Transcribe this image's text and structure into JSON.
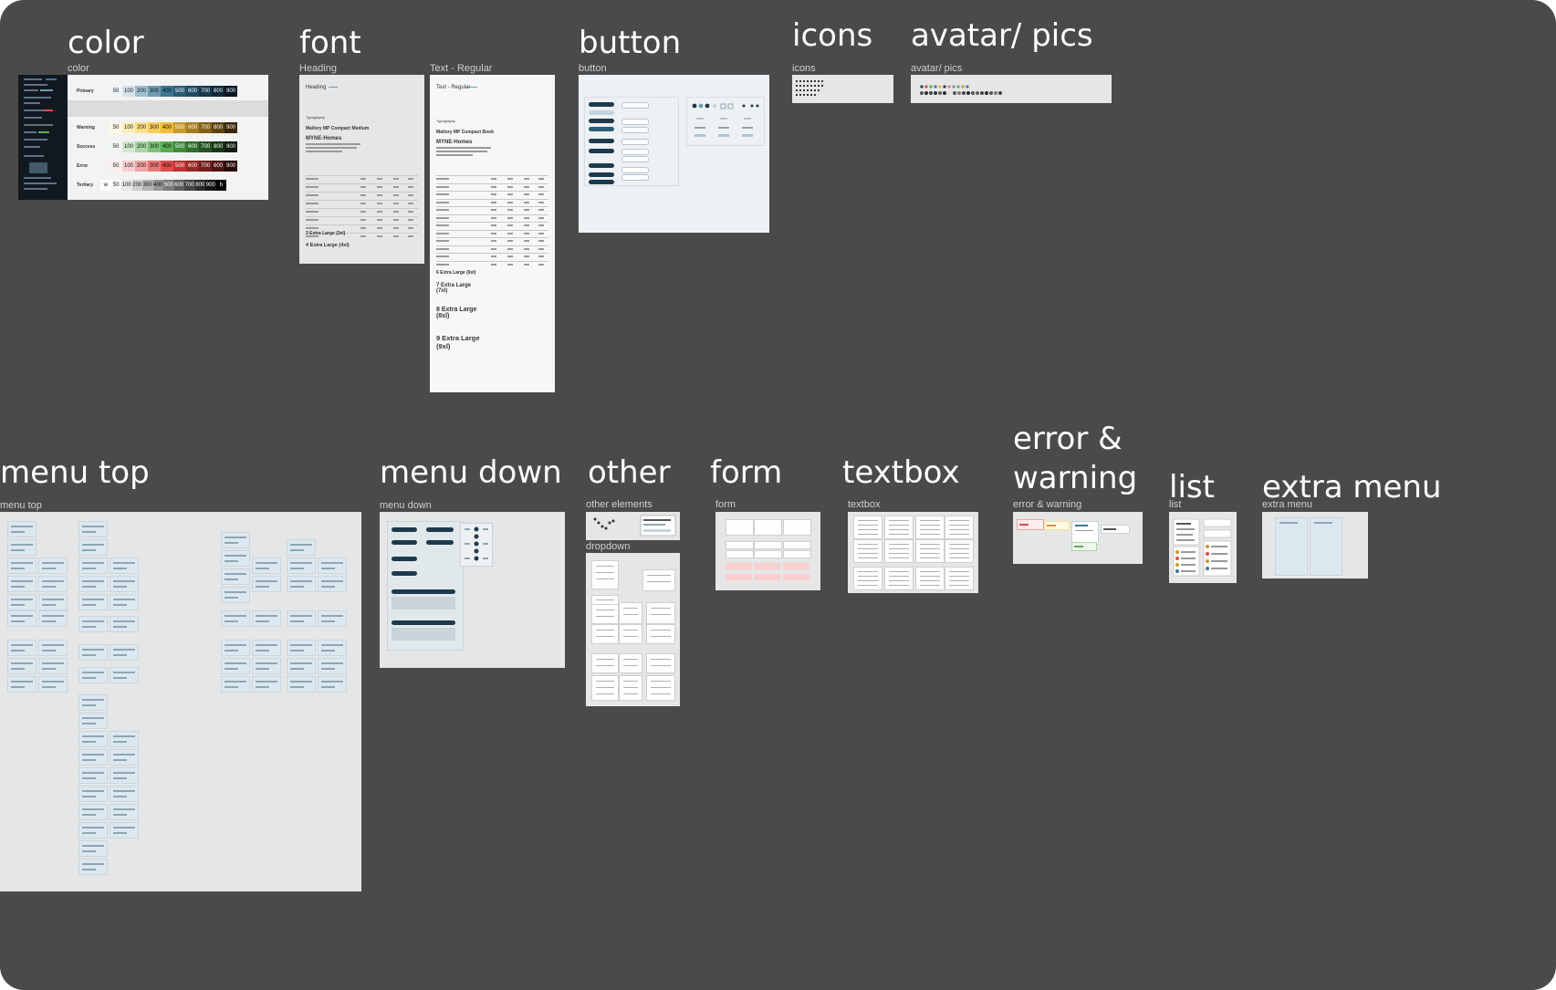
{
  "sections": {
    "color": "color",
    "font": "font",
    "button": "button",
    "icons": "icons",
    "avatar": "avatar/ pics",
    "menu_top": "menu top",
    "menu_down": "menu down",
    "other": "other",
    "form": "form",
    "textbox": "textbox",
    "error_warning": "error & warning",
    "list": "list",
    "extra_menu": "extra menu"
  },
  "frame_labels": {
    "color": "color",
    "heading": "Heading",
    "text_regular": "Text - Regular",
    "button": "button",
    "icons": "icons",
    "avatar": "avatar/ pics",
    "menu_top": "menu top",
    "menu_down": "menu down",
    "other_elements": "other elements",
    "dropdown": "dropdown",
    "form": "form",
    "textbox": "textbox",
    "error_warning": "error & warning",
    "list": "list",
    "extra_menu": "extra menu"
  },
  "color_frame": {
    "palettes": [
      {
        "name": "Primary",
        "shades": [
          "50",
          "100",
          "200",
          "300",
          "400",
          "500",
          "600",
          "700",
          "800",
          "900"
        ],
        "colors": [
          "#eef4f8",
          "#d3e2ec",
          "#9fbfd0",
          "#6f9cb3",
          "#3f7693",
          "#2a5d78",
          "#1f4a61",
          "#17394b",
          "#0f2836",
          "#081822"
        ]
      },
      {
        "name": "Warning",
        "shades": [
          "50",
          "100",
          "200",
          "300",
          "400",
          "500",
          "600",
          "700",
          "800",
          "900"
        ],
        "colors": [
          "#fff8e6",
          "#ffeeb8",
          "#ffe08a",
          "#f7cf5c",
          "#f0bd38",
          "#c99a2a",
          "#a57d20",
          "#806017",
          "#5b430f",
          "#382807"
        ]
      },
      {
        "name": "Success",
        "shades": [
          "50",
          "100",
          "200",
          "300",
          "400",
          "500",
          "600",
          "700",
          "800",
          "900"
        ],
        "colors": [
          "#eef7ee",
          "#d1ebcf",
          "#a7d6a3",
          "#7cc277",
          "#58ad52",
          "#3e8b3a",
          "#306e2d",
          "#245222",
          "#183717",
          "#0c1c0b"
        ]
      },
      {
        "name": "Error",
        "shades": [
          "50",
          "100",
          "200",
          "300",
          "400",
          "500",
          "600",
          "700",
          "800",
          "900"
        ],
        "colors": [
          "#fdeeee",
          "#f9cfcf",
          "#f2a3a3",
          "#ea7575",
          "#e04b4b",
          "#c23232",
          "#9a2727",
          "#731d1d",
          "#4c1313",
          "#260909"
        ]
      },
      {
        "name": "Tertiary",
        "shades": [
          "w",
          "50",
          "100",
          "200",
          "300",
          "400",
          "500",
          "600",
          "700",
          "800",
          "900",
          "b"
        ],
        "colors": [
          "#ffffff",
          "#f7f7f7",
          "#e6e6e6",
          "#cfcfcf",
          "#b3b3b3",
          "#969696",
          "#7a7a7a",
          "#5e5e5e",
          "#434343",
          "#2b2b2b",
          "#161616",
          "#000000"
        ]
      }
    ]
  },
  "font_frame": {
    "heading_title": "Heading",
    "heading_typography": "Typography",
    "heading_font_name": "Mallory MP Compact Medium",
    "heading_sample": "MYNE-Homes",
    "heading_rows": [
      "3 Extra Large (3xl)",
      "4 Extra Large (4xl)"
    ],
    "text_title": "Text - Regular",
    "text_typography": "Typography",
    "text_font_name": "Mallory MP Compact Book",
    "text_sample": "MYNE-Homes",
    "text_rows": [
      "6 Extra Large (6xl)",
      "7 Extra Large (7xl)",
      "8 Extra Large (8xl)",
      "9 Extra Large (9xl)"
    ]
  },
  "colors": {
    "canvas": "#4a4a4a",
    "frame": "#e6e6e6",
    "primary_dark": "#1d3a4c",
    "card": "#dce8ef"
  }
}
